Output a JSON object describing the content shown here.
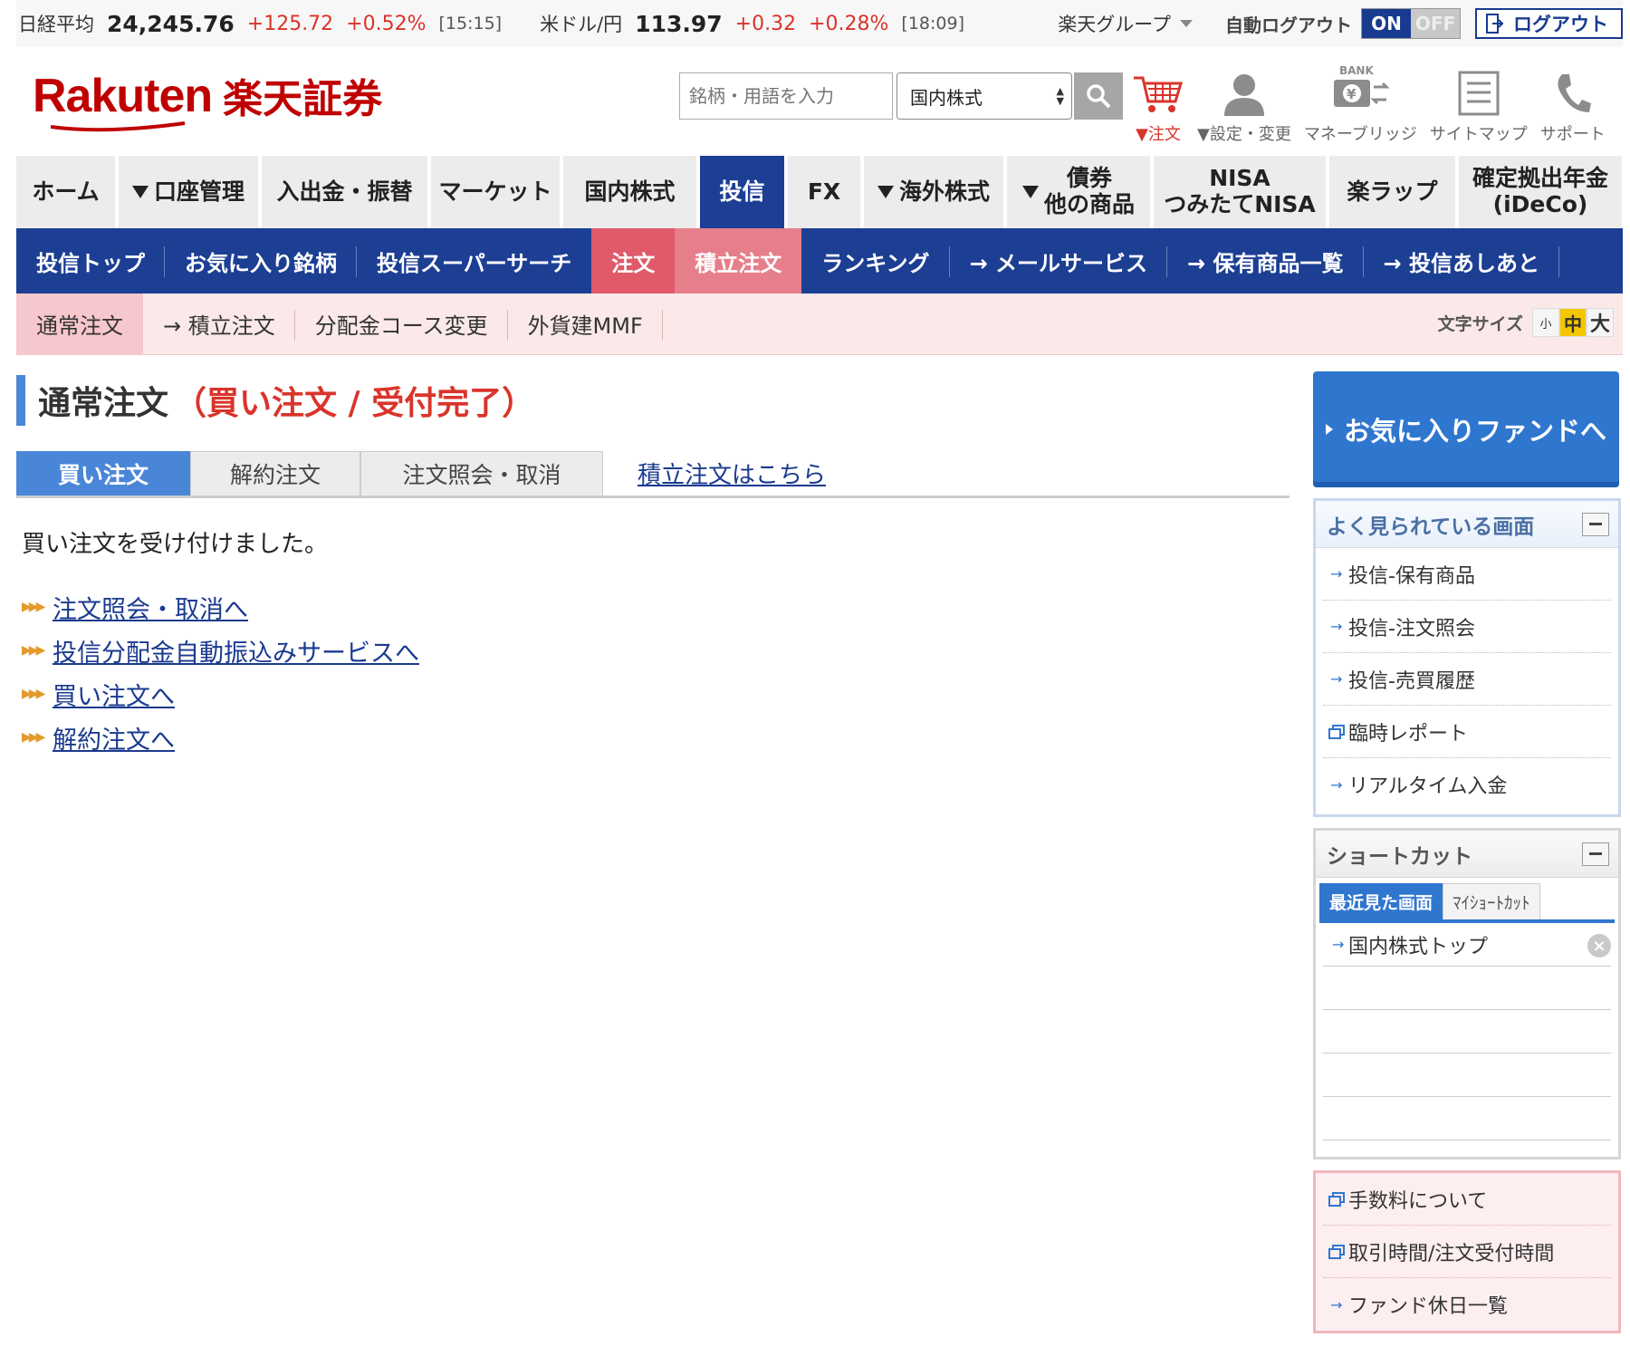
{
  "market": {
    "nikkei": {
      "label": "日経平均",
      "value": "24,245.76",
      "change": "+125.72",
      "pct": "+0.52%",
      "time": "[15:15]"
    },
    "usdjpy": {
      "label": "米ドル/円",
      "value": "113.97",
      "change": "+0.32",
      "pct": "+0.28%",
      "time": "[18:09]"
    },
    "group_label": "楽天グループ",
    "auto_logout_label": "自動ログアウト",
    "toggle_on": "ON",
    "toggle_off": "OFF",
    "logout_label": "ログアウト"
  },
  "header": {
    "logo_text": "Rakuten",
    "logo_jp": "楽天証券",
    "search_placeholder": "銘柄・用語を入力",
    "search_scope": "国内株式",
    "icons": [
      {
        "name": "cart-icon",
        "label": "▼注文"
      },
      {
        "name": "user-icon",
        "label": "▼設定・変更"
      },
      {
        "name": "bank-icon",
        "label": "マネーブリッジ",
        "badge": "BANK"
      },
      {
        "name": "sitemap-icon",
        "label": "サイトマップ"
      },
      {
        "name": "phone-icon",
        "label": "サポート"
      }
    ]
  },
  "main_nav": [
    {
      "label": "ホーム"
    },
    {
      "label": "口座管理",
      "dropdown": true
    },
    {
      "label": "入出金・振替"
    },
    {
      "label": "マーケット"
    },
    {
      "label": "国内株式"
    },
    {
      "label": "投信",
      "active": true
    },
    {
      "label": "FX"
    },
    {
      "label": "海外株式",
      "dropdown": true
    },
    {
      "label_line1": "債券",
      "label_line2": "他の商品",
      "dropdown": true
    },
    {
      "label_line1": "NISA",
      "label_line2": "つみたてNISA"
    },
    {
      "label": "楽ラップ"
    },
    {
      "label_line1": "確定拠出年金",
      "label_line2": "(iDeCo)"
    }
  ],
  "sub_nav": [
    "投信トップ",
    "お気に入り銘柄",
    "投信スーパーサーチ",
    "注文",
    "積立注文",
    "ランキング",
    "→ メールサービス",
    "→ 保有商品一覧",
    "→ 投信あしあと"
  ],
  "ter_nav": [
    "通常注文",
    "→ 積立注文",
    "分配金コース変更",
    "外貨建MMF"
  ],
  "font_size": {
    "label": "文字サイズ",
    "small": "小",
    "medium": "中",
    "large": "大"
  },
  "page": {
    "title_main": "通常注文",
    "title_sub": "（買い注文 / 受付完了）",
    "tabs": [
      "買い注文",
      "解約注文",
      "注文照会・取消"
    ],
    "tab_link": "積立注文はこちら",
    "message": "買い注文を受け付けました。",
    "links": [
      "注文照会・取消へ",
      "投信分配金自動振込みサービスへ",
      "買い注文へ",
      "解約注文へ"
    ]
  },
  "sidebar": {
    "fav_button": "お気に入りファンドへ",
    "frequent_title": "よく見られている画面",
    "frequent_items": [
      "投信-保有商品",
      "投信-注文照会",
      "投信-売買履歴",
      "臨時レポート",
      "リアルタイム入金"
    ],
    "shortcut_title": "ショートカット",
    "shortcut_tabs": [
      "最近見た画面",
      "ﾏｲｼｮｰﾄｶｯﾄ"
    ],
    "shortcut_items": [
      "国内株式トップ"
    ],
    "info_items": [
      "手数料について",
      "取引時間/注文受付時間",
      "ファンド休日一覧"
    ]
  },
  "colors": {
    "brand_red": "#bf0000",
    "nav_blue": "#1c3f94",
    "accent_blue": "#2f76cf",
    "pink": "#e05a6a",
    "positive": "#d9342b"
  }
}
